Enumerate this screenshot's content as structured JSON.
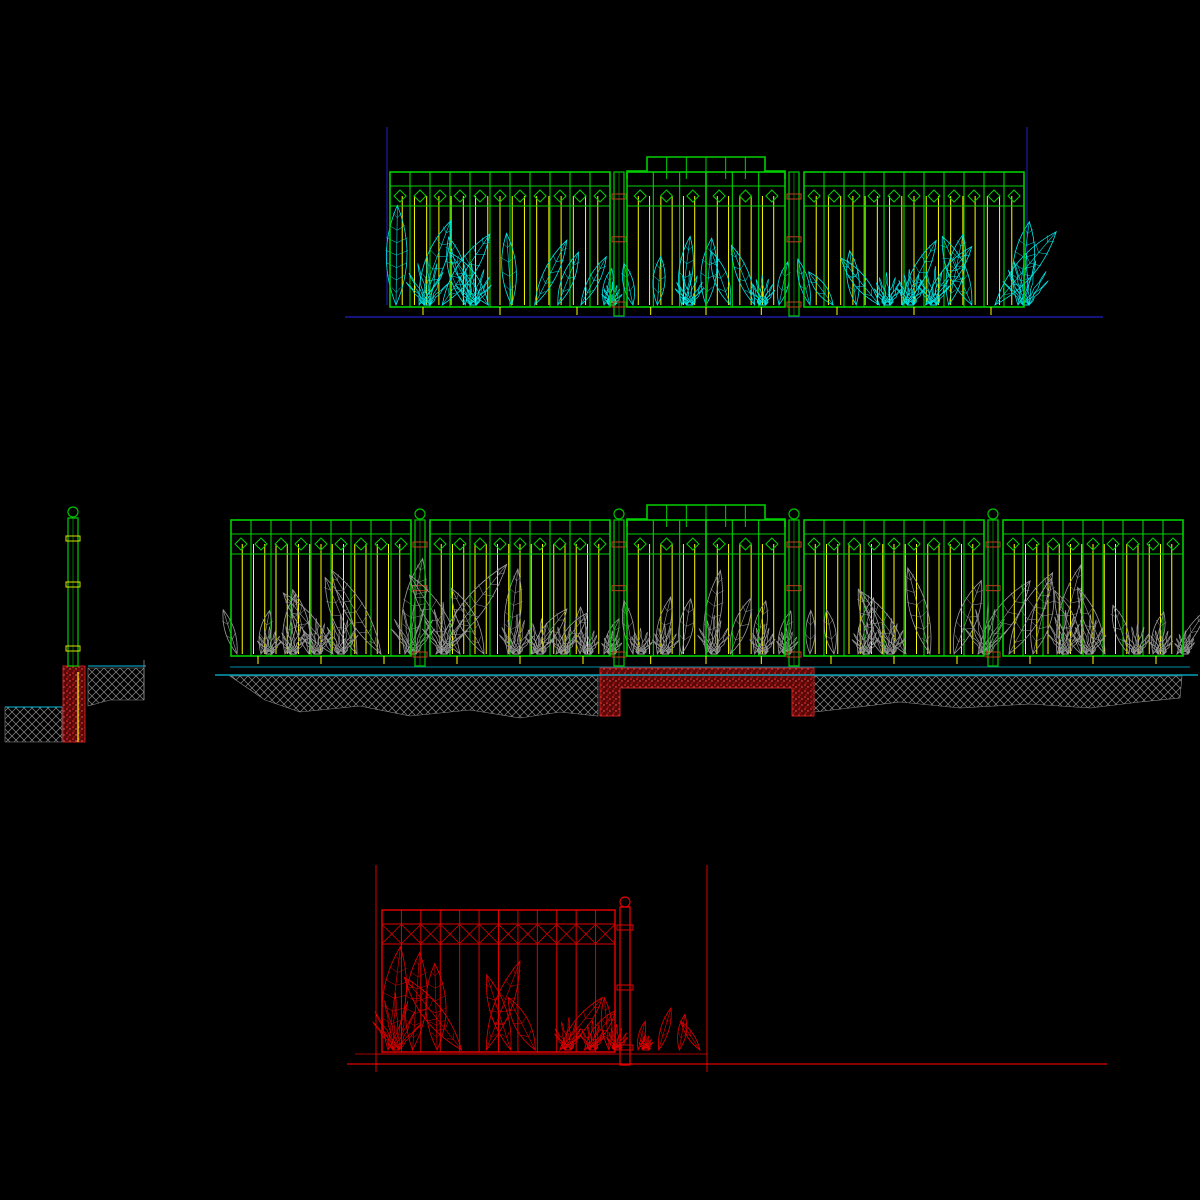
{
  "drawing": {
    "background": "#000000",
    "colors": {
      "frame": "#00d000",
      "infill": "#ffff00",
      "foliage_cyan": "#00e5e5",
      "foliage_gray": "#9a9a9a",
      "guide_blue": "#2020c8",
      "ground_line": "#00c0e0",
      "earth_hatch": "#8c8c8c",
      "footing": "#b01818",
      "footing_speckle": "#ff3030",
      "detail_red": "#e00000",
      "post": "#00c000"
    },
    "views": [
      {
        "id": "gate-elevation-upper",
        "foliage": "cyan"
      },
      {
        "id": "fence-elevation-full",
        "foliage": "gray"
      },
      {
        "id": "post-section-detail"
      },
      {
        "id": "panel-detail-red"
      }
    ]
  }
}
